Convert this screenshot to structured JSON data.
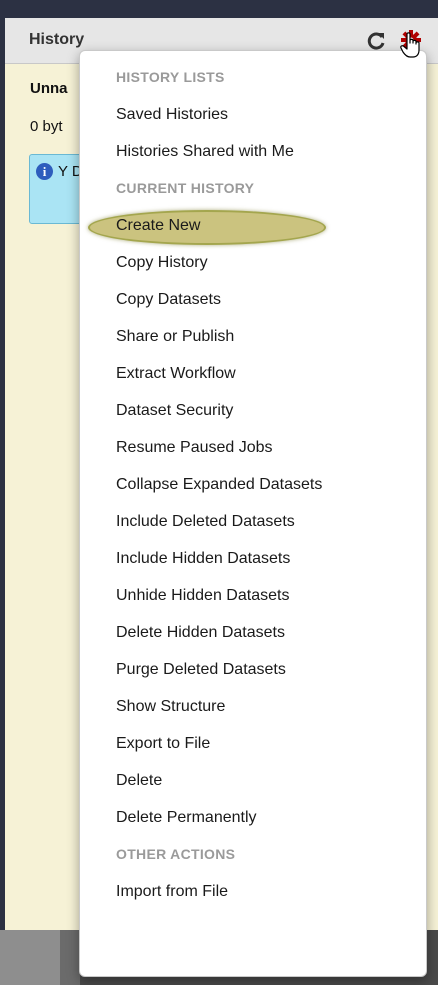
{
  "panel": {
    "title": "History",
    "history_name": "Unna",
    "history_size": "0 byt",
    "info_message": "Y D"
  },
  "icons": {
    "refresh": "refresh-icon",
    "gear": "gear-icon",
    "cursor": "hand-cursor-icon",
    "info": "info-icon"
  },
  "colors": {
    "gear": "#b00000",
    "panel_background": "#f6f2d6",
    "info_background": "#aae4f4",
    "highlight": "#cbc37f"
  },
  "menu": {
    "sections": [
      {
        "header": "HISTORY LISTS",
        "items": [
          "Saved Histories",
          "Histories Shared with Me"
        ]
      },
      {
        "header": "CURRENT HISTORY",
        "items": [
          "Create New",
          "Copy History",
          "Copy Datasets",
          "Share or Publish",
          "Extract Workflow",
          "Dataset Security",
          "Resume Paused Jobs",
          "Collapse Expanded Datasets",
          "Include Deleted Datasets",
          "Include Hidden Datasets",
          "Unhide Hidden Datasets",
          "Delete Hidden Datasets",
          "Purge Deleted Datasets",
          "Show Structure",
          "Export to File",
          "Delete",
          "Delete Permanently"
        ]
      },
      {
        "header": "OTHER ACTIONS",
        "items": [
          "Import from File"
        ]
      }
    ],
    "highlighted_item": "Create New"
  }
}
